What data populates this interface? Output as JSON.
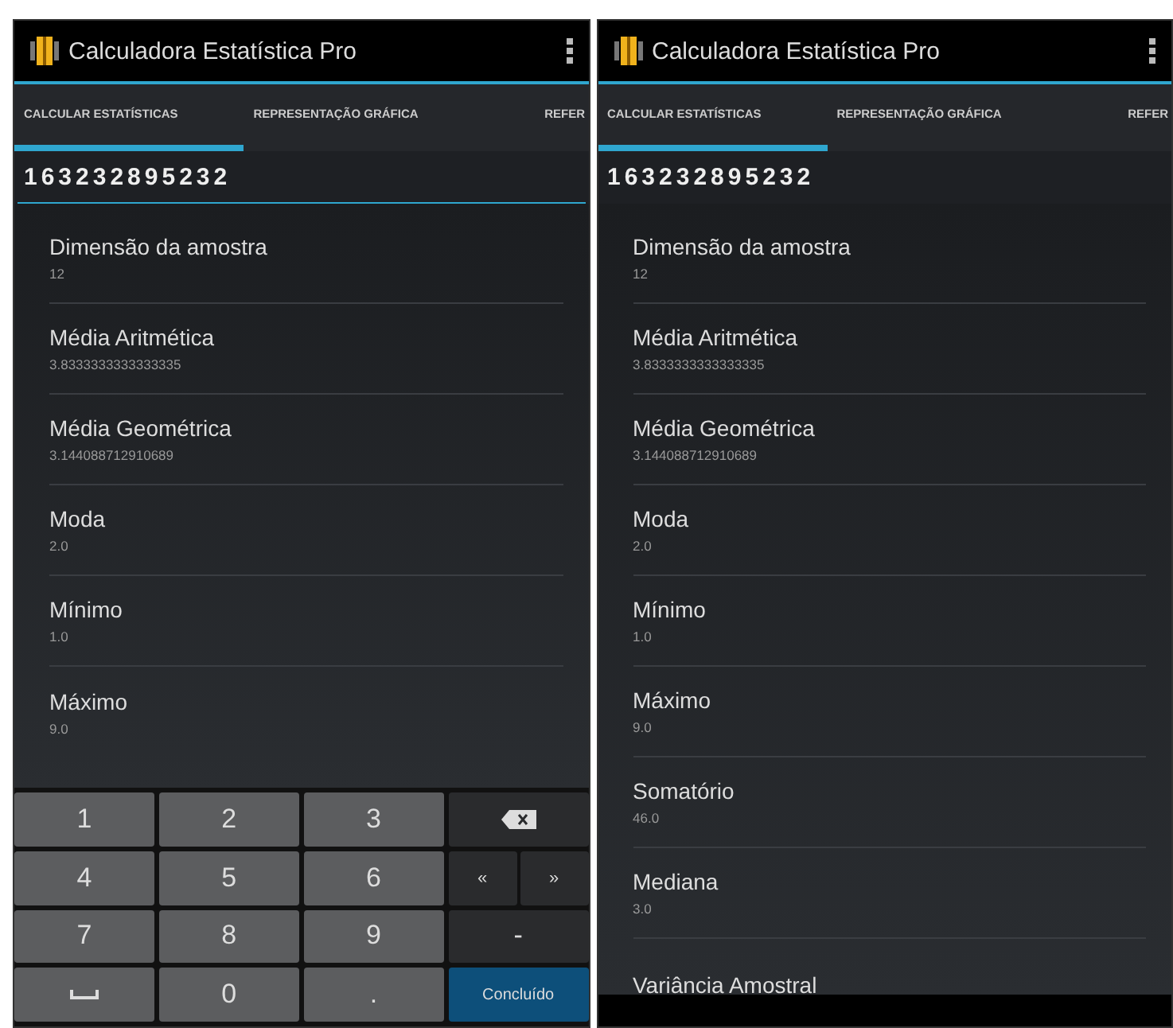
{
  "phones": [
    {
      "app_title": "Calculadora Estatística Pro",
      "tabs": [
        {
          "label": "CALCULAR ESTATÍSTICAS",
          "selected": true
        },
        {
          "label": "REPRESENTAÇÃO GRÁFICA",
          "selected": false
        },
        {
          "label": "REFER",
          "selected": false
        }
      ],
      "input": {
        "value": "163232895232",
        "focused": true
      },
      "stats": [
        {
          "name": "Dimensão da amostra",
          "value": "12"
        },
        {
          "name": "Média Aritmética",
          "value": "3.8333333333333335"
        },
        {
          "name": "Média Geométrica",
          "value": "3.144088712910689"
        },
        {
          "name": "Moda",
          "value": "2.0"
        },
        {
          "name": "Mínimo",
          "value": "1.0"
        },
        {
          "name": "Máximo",
          "value": "9.0"
        }
      ],
      "keyboard": [
        [
          {
            "kind": "digit",
            "label": "1"
          },
          {
            "kind": "digit",
            "label": "2"
          },
          {
            "kind": "digit",
            "label": "3"
          },
          {
            "kind": "backspace"
          }
        ],
        [
          {
            "kind": "digit",
            "label": "4"
          },
          {
            "kind": "digit",
            "label": "5"
          },
          {
            "kind": "digit",
            "label": "6"
          },
          {
            "kind": "pair",
            "labels": [
              "«",
              "»"
            ]
          }
        ],
        [
          {
            "kind": "digit",
            "label": "7"
          },
          {
            "kind": "digit",
            "label": "8"
          },
          {
            "kind": "digit",
            "label": "9"
          },
          {
            "kind": "function",
            "label": "-"
          }
        ],
        [
          {
            "kind": "space"
          },
          {
            "kind": "digit",
            "label": "0"
          },
          {
            "kind": "digit",
            "label": "."
          },
          {
            "kind": "done",
            "label": "Concluído"
          }
        ]
      ]
    },
    {
      "app_title": "Calculadora Estatística Pro",
      "tabs": [
        {
          "label": "CALCULAR ESTATÍSTICAS",
          "selected": true
        },
        {
          "label": "REPRESENTAÇÃO GRÁFICA",
          "selected": false
        },
        {
          "label": "REFER",
          "selected": false
        }
      ],
      "input": {
        "value": "163232895232",
        "focused": false
      },
      "stats": [
        {
          "name": "Dimensão da amostra",
          "value": "12"
        },
        {
          "name": "Média Aritmética",
          "value": "3.8333333333333335"
        },
        {
          "name": "Média Geométrica",
          "value": "3.144088712910689"
        },
        {
          "name": "Moda",
          "value": "2.0"
        },
        {
          "name": "Mínimo",
          "value": "1.0"
        },
        {
          "name": "Máximo",
          "value": "9.0"
        },
        {
          "name": "Somatório",
          "value": "46.0"
        },
        {
          "name": "Mediana",
          "value": "3.0"
        },
        {
          "name": "Variância Amostral"
        }
      ]
    }
  ]
}
